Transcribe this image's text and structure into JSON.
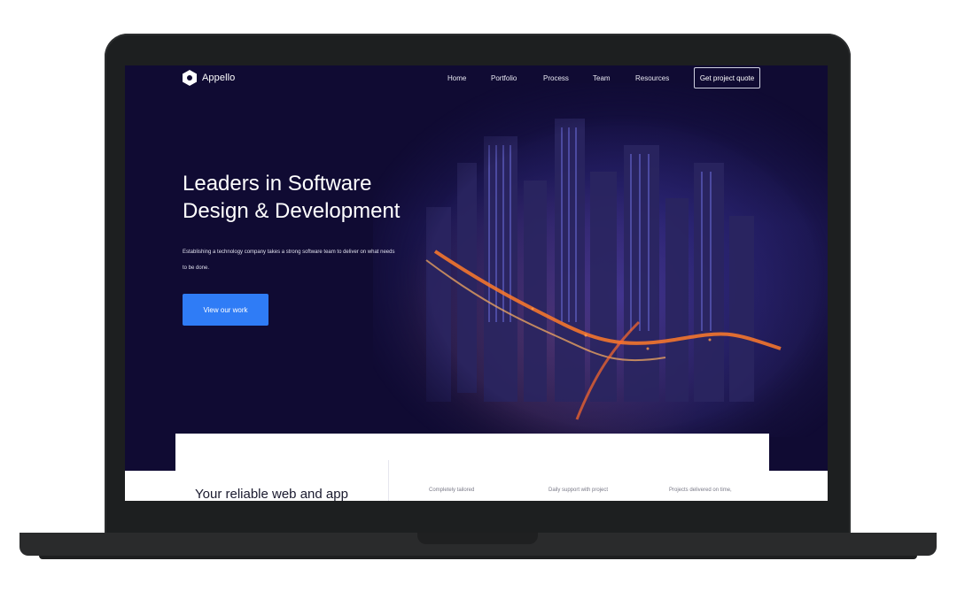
{
  "site": {
    "logo_text": "Appello",
    "nav": [
      "Home",
      "Portfolio",
      "Process",
      "Team",
      "Resources"
    ],
    "quote_button": "Get project quote",
    "hero_title_line1": "Leaders in Software",
    "hero_title_line2": "Design & Development",
    "hero_subtitle": "Establishing a technology company takes a strong software team to deliver on what needs to be done.",
    "cta_label": "View our work",
    "section_title": "Your reliable web and app",
    "features": [
      "Completely tailored",
      "Daily support with project",
      "Projects delivered on time,"
    ]
  },
  "colors": {
    "background": "#100b33",
    "accent": "#2f7cf6",
    "frame": "#1d1f20"
  },
  "icons": {
    "logo": "hexagon-logo-icon"
  }
}
